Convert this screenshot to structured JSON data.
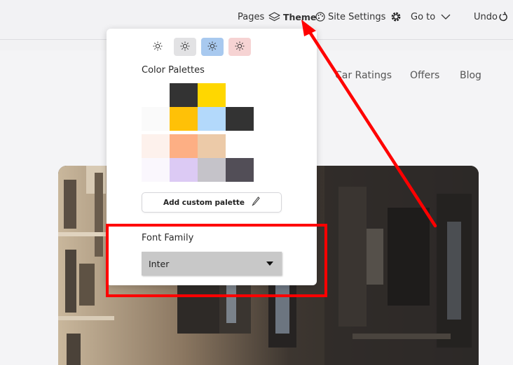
{
  "topbar": {
    "pages_label": "Pages",
    "theme_label": "Theme",
    "site_settings_label": "Site Settings",
    "goto_label": "Go to",
    "undo_label": "Undo"
  },
  "site": {
    "nav": [
      "Car Ratings",
      "Offers",
      "Blog"
    ]
  },
  "theme_popover": {
    "modes": [
      "light-mode-1",
      "light-mode-2",
      "light-mode-3",
      "light-mode-4"
    ],
    "selected_mode_index": 2,
    "color_palettes_title": "Color Palettes",
    "palettes": [
      [
        "#333333",
        "#ffd700"
      ],
      [
        "#fafafa",
        "#ffc107",
        "#b3d9fb",
        "#333333"
      ],
      [
        "#fdf1ec",
        "#fdaf84",
        "#eccaa8"
      ],
      [
        "#faf7fd",
        "#dccaf4",
        "#c5c3c9",
        "#524e57"
      ]
    ],
    "add_custom_palette_label": "Add custom palette",
    "font_family_title": "Font Family",
    "font_family_value": "Inter"
  },
  "annotation_color": "#ff0000"
}
